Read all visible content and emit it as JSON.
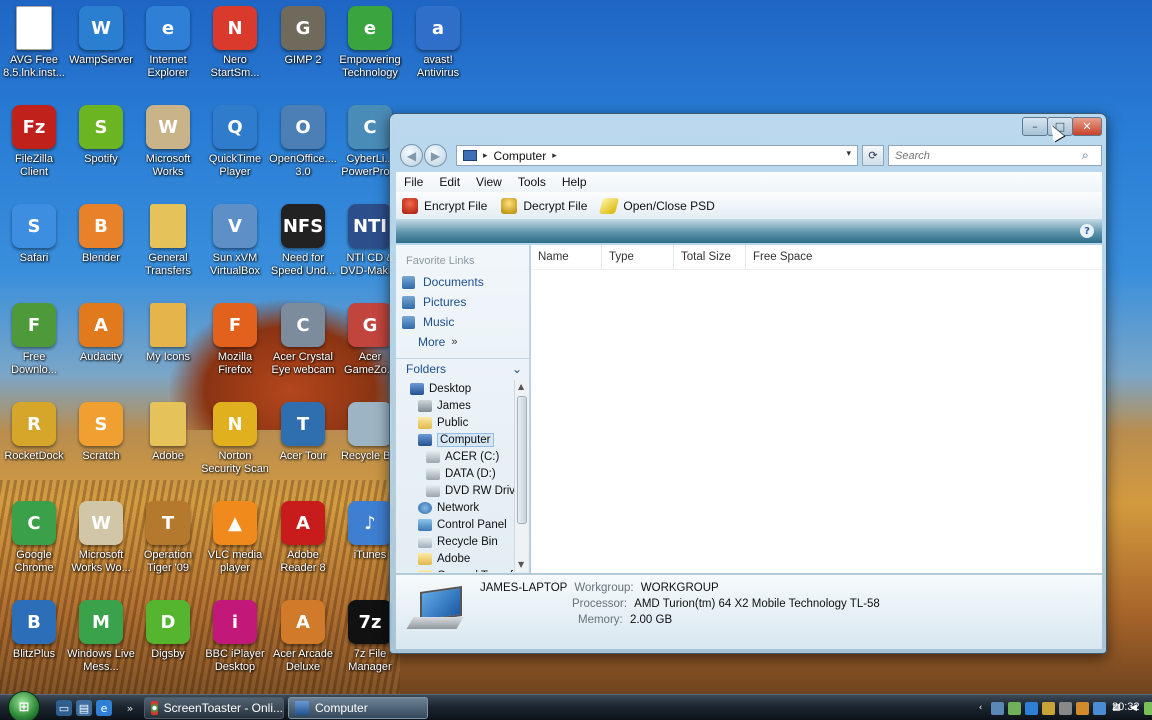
{
  "desktop": {
    "icons": [
      {
        "label": "AVG Free 8.5.lnk.inst...",
        "icon": "document-icon",
        "color": "#ffffff",
        "glyph": ""
      },
      {
        "label": "WampServer",
        "icon": "wampserver-icon",
        "color": "#2a7fd0",
        "glyph": "W"
      },
      {
        "label": "Internet Explorer",
        "icon": "internet-explorer-icon",
        "color": "#2f7fd6",
        "glyph": "e"
      },
      {
        "label": "Nero StartSm...",
        "icon": "nero-icon",
        "color": "#d93a2c",
        "glyph": "N"
      },
      {
        "label": "GIMP 2",
        "icon": "gimp-icon",
        "color": "#6f6a5c",
        "glyph": "G"
      },
      {
        "label": "Empowering Technology",
        "icon": "empowering-technology-icon",
        "color": "#3aa53f",
        "glyph": "e"
      },
      {
        "label": "avast! Antivirus",
        "icon": "avast-icon",
        "color": "#2f6fc9",
        "glyph": "a"
      },
      {
        "label": "FileZilla Client",
        "icon": "filezilla-icon",
        "color": "#c0211b",
        "glyph": "Fz"
      },
      {
        "label": "Spotify",
        "icon": "spotify-icon",
        "color": "#6ab521",
        "glyph": "S"
      },
      {
        "label": "Microsoft Works",
        "icon": "microsoft-works-icon",
        "color": "#c9b48a",
        "glyph": "W"
      },
      {
        "label": "QuickTime Player",
        "icon": "quicktime-icon",
        "color": "#2f7ccd",
        "glyph": "Q"
      },
      {
        "label": "OpenOffice.... 3.0",
        "icon": "openoffice-icon",
        "color": "#4b7fb6",
        "glyph": "O"
      },
      {
        "label": "CyberLi... PowerPro...",
        "icon": "cyberlink-icon",
        "color": "#4a8cb8",
        "glyph": "C"
      },
      {
        "label": "Safari",
        "icon": "safari-icon",
        "color": "#3d8de0",
        "glyph": "S"
      },
      {
        "label": "Blender",
        "icon": "blender-icon",
        "color": "#e8822a",
        "glyph": "B"
      },
      {
        "label": "General Transfers",
        "icon": "folder-icon",
        "color": "#e5c25a",
        "glyph": ""
      },
      {
        "label": "Sun xVM VirtualBox",
        "icon": "virtualbox-icon",
        "color": "#5f8fc7",
        "glyph": "V"
      },
      {
        "label": "Need for Speed Und...",
        "icon": "need-for-speed-icon",
        "color": "#222222",
        "glyph": "NFS"
      },
      {
        "label": "NTI CD & DVD-Maki...",
        "icon": "nti-cd-icon",
        "color": "#2c4e8a",
        "glyph": "NTI"
      },
      {
        "label": "Free Downlo...",
        "icon": "free-download-icon",
        "color": "#4e9a3a",
        "glyph": "F"
      },
      {
        "label": "Audacity",
        "icon": "audacity-icon",
        "color": "#e07a1d",
        "glyph": "A"
      },
      {
        "label": "My Icons",
        "icon": "folder-icon",
        "color": "#e5b44a",
        "glyph": ""
      },
      {
        "label": "Mozilla Firefox",
        "icon": "firefox-icon",
        "color": "#e2621d",
        "glyph": "F"
      },
      {
        "label": "Acer Crystal Eye webcam",
        "icon": "webcam-icon",
        "color": "#7d8c9c",
        "glyph": "C"
      },
      {
        "label": "Acer GameZo...",
        "icon": "gamezone-icon",
        "color": "#c2453d",
        "glyph": "G"
      },
      {
        "label": "RocketDock",
        "icon": "rocketdock-icon",
        "color": "#d6a62a",
        "glyph": "R"
      },
      {
        "label": "Scratch",
        "icon": "scratch-icon",
        "color": "#f0a030",
        "glyph": "S"
      },
      {
        "label": "Adobe",
        "icon": "folder-icon",
        "color": "#e5c25a",
        "glyph": ""
      },
      {
        "label": "Norton Security Scan",
        "icon": "norton-icon",
        "color": "#e0b01e",
        "glyph": "N"
      },
      {
        "label": "Acer Tour",
        "icon": "acer-tour-icon",
        "color": "#2f6fb0",
        "glyph": "T"
      },
      {
        "label": "Recycle Bin",
        "icon": "recycle-bin-icon",
        "color": "#9db4c4",
        "glyph": ""
      },
      {
        "label": "Google Chrome",
        "icon": "chrome-icon",
        "color": "#3aa04a",
        "glyph": "C"
      },
      {
        "label": "Microsoft Works Wo...",
        "icon": "works-word-icon",
        "color": "#d2c6a8",
        "glyph": "W"
      },
      {
        "label": "Operation Tiger '09",
        "icon": "operation-tiger-icon",
        "color": "#b5792d",
        "glyph": "T"
      },
      {
        "label": "VLC media player",
        "icon": "vlc-icon",
        "color": "#f08a1c",
        "glyph": "▲"
      },
      {
        "label": "Adobe Reader 8",
        "icon": "adobe-reader-icon",
        "color": "#c81b1b",
        "glyph": "A"
      },
      {
        "label": "iTunes",
        "icon": "itunes-icon",
        "color": "#3f7fd2",
        "glyph": "♪"
      },
      {
        "label": "BlitzPlus",
        "icon": "blitzplus-icon",
        "color": "#2c6fb8",
        "glyph": "B"
      },
      {
        "label": "Windows Live Mess...",
        "icon": "windows-live-messenger-icon",
        "color": "#3aa24a",
        "glyph": "M"
      },
      {
        "label": "Digsby",
        "icon": "digsby-icon",
        "color": "#55b52e",
        "glyph": "D"
      },
      {
        "label": "BBC iPlayer Desktop",
        "icon": "bbc-iplayer-icon",
        "color": "#c2187a",
        "glyph": "i"
      },
      {
        "label": "Acer Arcade Deluxe",
        "icon": "acer-arcade-icon",
        "color": "#d07a2a",
        "glyph": "A"
      },
      {
        "label": "7z File Manager",
        "icon": "7zip-icon",
        "color": "#111111",
        "glyph": "7z"
      }
    ]
  },
  "explorer": {
    "title_buttons": {
      "minimize": "–",
      "maximize": "□",
      "close": "✕"
    },
    "address": {
      "location": "Computer",
      "separator": "▸",
      "dropdown": "▾"
    },
    "search": {
      "placeholder": "Search"
    },
    "menu": [
      "File",
      "Edit",
      "View",
      "Tools",
      "Help"
    ],
    "toolbar": {
      "encrypt": "Encrypt File",
      "decrypt": "Decrypt File",
      "psd": "Open/Close PSD"
    },
    "favorites": {
      "heading": "Favorite Links",
      "links": [
        "Documents",
        "Pictures",
        "Music"
      ],
      "more": "More",
      "more_chevron": "»"
    },
    "folders_heading": "Folders",
    "folders_chevron": "⌄",
    "tree": [
      {
        "label": "Desktop",
        "icon": "pc",
        "indent": 0
      },
      {
        "label": "James",
        "icon": "user",
        "indent": 1
      },
      {
        "label": "Public",
        "icon": "folder",
        "indent": 1
      },
      {
        "label": "Computer",
        "icon": "pc",
        "indent": 1,
        "selected": true
      },
      {
        "label": "ACER (C:)",
        "icon": "drive",
        "indent": 2
      },
      {
        "label": "DATA (D:)",
        "icon": "drive",
        "indent": 2
      },
      {
        "label": "DVD RW Driv",
        "icon": "drive",
        "indent": 2
      },
      {
        "label": "Network",
        "icon": "net",
        "indent": 1
      },
      {
        "label": "Control Panel",
        "icon": "cp",
        "indent": 1
      },
      {
        "label": "Recycle Bin",
        "icon": "bin",
        "indent": 1
      },
      {
        "label": "Adobe",
        "icon": "folder",
        "indent": 1
      },
      {
        "label": "General Transf",
        "icon": "folder",
        "indent": 1
      }
    ],
    "columns": [
      "Name",
      "Type",
      "Total Size",
      "Free Space"
    ],
    "details": {
      "computer_name": "JAMES-LAPTOP",
      "workgroup_label": "Workgroup:",
      "workgroup_value": "WORKGROUP",
      "processor_label": "Processor:",
      "processor_value": "AMD Turion(tm) 64 X2 Mobile Technology TL-58",
      "memory_label": "Memory:",
      "memory_value": "2.00 GB"
    },
    "help": "?"
  },
  "taskbar": {
    "start": "⊞",
    "tasks": [
      {
        "label": "ScreenToaster - Onli...",
        "icon": "chrome-icon"
      },
      {
        "label": "Computer",
        "icon": "computer-icon",
        "active": true
      }
    ],
    "clock": "20:32"
  }
}
